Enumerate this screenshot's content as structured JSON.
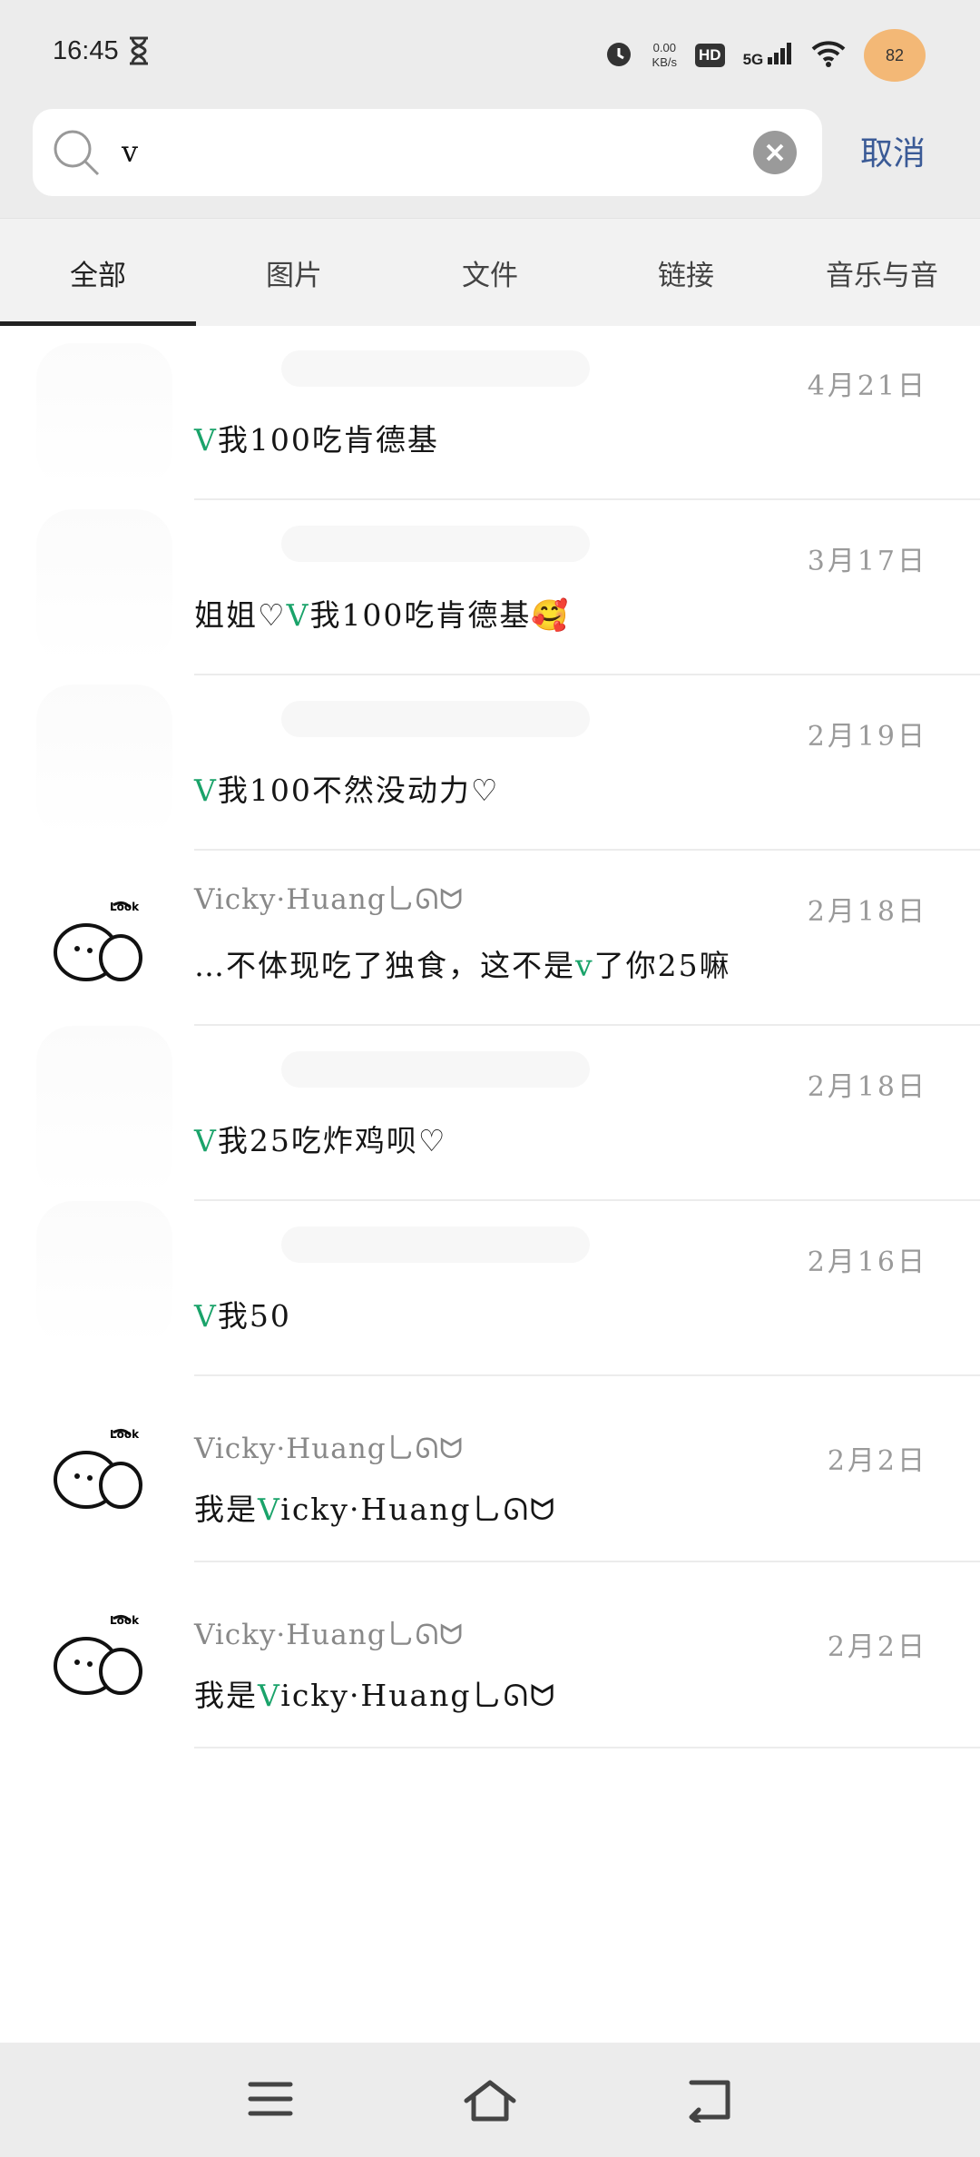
{
  "status_bar": {
    "time": "16:45",
    "net_speed_value": "0.00",
    "net_speed_unit": "KB/s",
    "hd_label": "HD",
    "network_label": "5G",
    "battery_level": "82",
    "icons": [
      "hourglass-icon",
      "alarm-icon",
      "hd-icon",
      "signal-icon",
      "wifi-icon",
      "battery-icon"
    ]
  },
  "search": {
    "query": "v",
    "cancel_label": "取消"
  },
  "tabs": [
    {
      "label": "全部",
      "active": true
    },
    {
      "label": "图片"
    },
    {
      "label": "文件"
    },
    {
      "label": "链接"
    },
    {
      "label": "音乐与音"
    }
  ],
  "results": [
    {
      "sender": "",
      "date": "4月21日",
      "message": {
        "pre": "",
        "hl": "V",
        "post": "我100吃肯德基"
      }
    },
    {
      "sender": "",
      "date": "3月17日",
      "message": {
        "pre": "姐姐♡",
        "hl": "V",
        "post": "我100吃肯德基🥰"
      }
    },
    {
      "sender": "",
      "date": "2月19日",
      "message": {
        "pre": "",
        "hl": "V",
        "post": "我100不然没动力♡"
      }
    },
    {
      "sender": "Vicky·Huang乚ᘏᗢ",
      "date": "2月18日",
      "message": {
        "pre": "…不体现吃了独食，这不是",
        "hl": "v",
        "post": "了你25嘛"
      }
    },
    {
      "sender": "",
      "date": "2月18日",
      "message": {
        "pre": "",
        "hl": "V",
        "post": "我25吃炸鸡呗♡"
      }
    },
    {
      "sender": "",
      "date": "2月16日",
      "message": {
        "pre": "",
        "hl": "V",
        "post": "我50"
      }
    },
    {
      "sender": "Vicky·Huang乚ᘏᗢ",
      "date": "2月2日",
      "message": {
        "pre": "我是",
        "hl": "V",
        "post": "icky·Huang乚ᘏᗢ"
      }
    },
    {
      "sender": "Vicky·Huang乚ᘏᗢ",
      "date": "2月2日",
      "message": {
        "pre": "我是",
        "hl": "V",
        "post": "icky·Huang乚ᘏᗢ"
      }
    }
  ],
  "nav": [
    "menu-icon",
    "home-icon",
    "back-icon"
  ],
  "colors": {
    "highlight": "#1aa36a",
    "cancel": "#3a5a96",
    "date": "#9a9a9a"
  }
}
